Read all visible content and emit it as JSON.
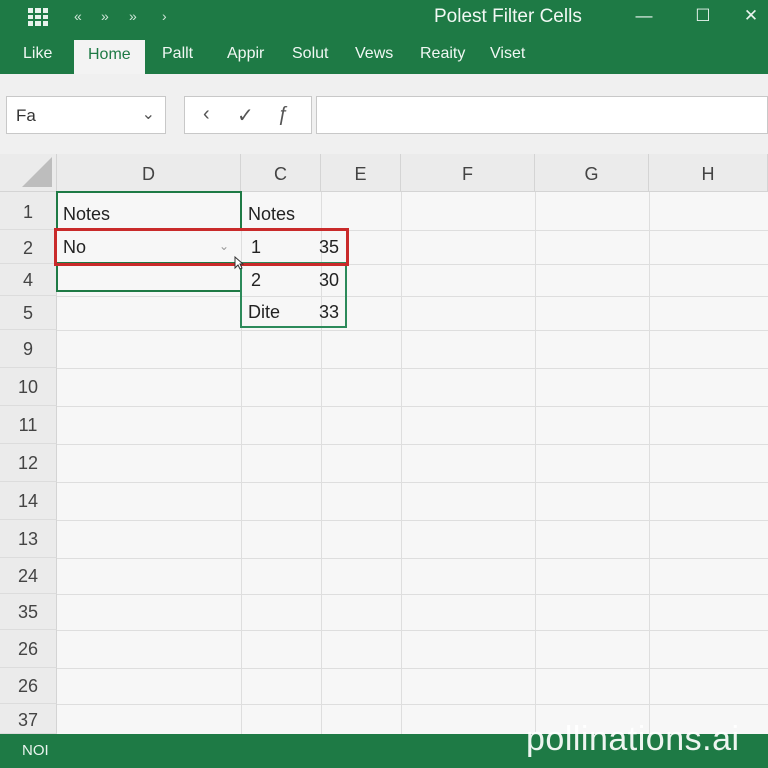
{
  "titlebar": {
    "title": "Polest Filter Cells",
    "quick_access": [
      "«",
      "»",
      "»",
      "›"
    ],
    "window_buttons": {
      "minimize": "—",
      "maximize": "☐",
      "close": "✕"
    }
  },
  "ribbon": {
    "tabs": [
      {
        "label": "Like"
      },
      {
        "label": "Home",
        "active": true
      },
      {
        "label": "Pallt"
      },
      {
        "label": "Appir"
      },
      {
        "label": "Solut"
      },
      {
        "label": "Vews"
      },
      {
        "label": "Reaity"
      },
      {
        "label": "Viset"
      }
    ]
  },
  "toolbar": {
    "name_box": "Fa",
    "name_box_chevron": "⌄",
    "fx_icons": [
      "‹",
      "✓",
      "ƒ"
    ],
    "formula_value": ""
  },
  "grid": {
    "columns": [
      "D",
      "C",
      "E",
      "F",
      "G",
      "H"
    ],
    "rows": [
      "1",
      "2",
      "4",
      "5",
      "9",
      "10",
      "11",
      "12",
      "14",
      "13",
      "24",
      "35",
      "26",
      "26",
      "37"
    ],
    "cells": {
      "d1": "Notes",
      "d2": "No",
      "c1": "Notes",
      "c2_label": "1",
      "c2_value": "35",
      "c4_label": "2",
      "c4_value": "30",
      "c5_label": "Dite",
      "c5_value": "33"
    },
    "dropdown_arrow": "⌄"
  },
  "statusbar": {
    "text": "NOI"
  },
  "watermark": "pollinations.ai",
  "colors": {
    "brand_green": "#1e7a45",
    "selection_red": "#c92a2a"
  }
}
